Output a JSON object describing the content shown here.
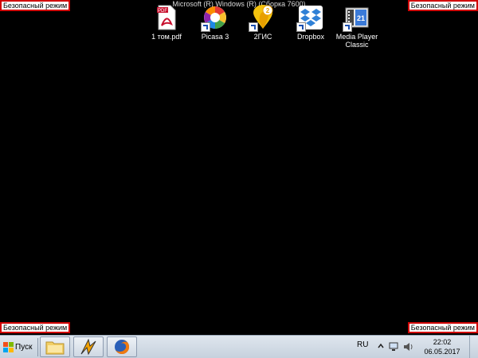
{
  "window_title": "Microsoft (R) Windows (R) (Сборка 7600)",
  "safe_mode_label": "Безопасный режим",
  "desktop_icons": [
    {
      "label": "1 том.pdf",
      "icon": "pdf-icon"
    },
    {
      "label": "Picasa 3",
      "icon": "picasa-icon"
    },
    {
      "label": "2ГИС",
      "icon": "2gis-icon"
    },
    {
      "label": "Dropbox",
      "icon": "dropbox-icon"
    },
    {
      "label": "Media Player Classic",
      "icon": "media-player-classic-icon"
    }
  ],
  "taskbar": {
    "start_label": "Пуск",
    "pinned": [
      {
        "name": "explorer",
        "icon": "folder-icon"
      },
      {
        "name": "winamp",
        "icon": "winamp-icon"
      },
      {
        "name": "firefox",
        "icon": "firefox-icon"
      }
    ]
  },
  "tray": {
    "language": "RU",
    "icons": [
      "show-hidden-icon",
      "network-icon",
      "volume-icon"
    ],
    "time": "22:02",
    "date": "06.05.2017"
  },
  "colors": {
    "desktop_bg": "#000000",
    "safe_mode_border": "#d00000",
    "taskbar_bg": "#d3dce6"
  }
}
